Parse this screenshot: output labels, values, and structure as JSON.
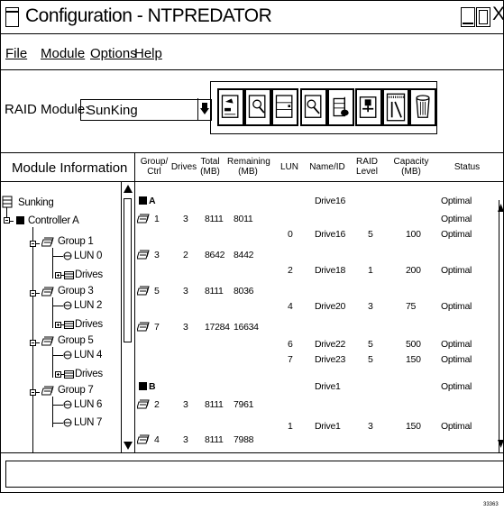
{
  "window": {
    "title": "Configuration - NTPREDATOR",
    "close_glyph": "X"
  },
  "menu": [
    {
      "label": "File"
    },
    {
      "label": "Module"
    },
    {
      "label": "Options"
    },
    {
      "label": "Help"
    }
  ],
  "raid": {
    "label": "RAID Module:",
    "value": "SunKing"
  },
  "toolbar": {
    "icons": [
      "configuration-icon",
      "status-icon",
      "maintenance-icon",
      "recovery-icon",
      "module-profile-icon",
      "add-module-icon",
      "tuning-icon",
      "delete-icon"
    ]
  },
  "left_header": "Module Information",
  "tree": {
    "root": "Sunking",
    "controller": "Controller A",
    "groups": [
      {
        "label": "Group 1",
        "lun": "LUN 0",
        "drives": "Drives"
      },
      {
        "label": "Group 3",
        "lun": "LUN 2",
        "drives": "Drives"
      },
      {
        "label": "Group 5",
        "lun": "LUN 4",
        "drives": "Drives"
      },
      {
        "label": "Group 7",
        "luns": [
          "LUN 6",
          "LUN 7"
        ]
      }
    ]
  },
  "columns": {
    "group_ctrl": [
      "Group/",
      "Ctrl"
    ],
    "drives": "Drives",
    "total": [
      "Total",
      "(MB)"
    ],
    "remaining": [
      "Remaining",
      "(MB)"
    ],
    "lun": "LUN",
    "name_id": "Name/ID",
    "raid_level": [
      "RAID",
      "Level"
    ],
    "capacity": [
      "Capacity",
      "(MB)"
    ],
    "status": "Status"
  },
  "rows": {
    "ctrlA": {
      "ctrl": "A",
      "name": "Drive16",
      "status": "Optimal"
    },
    "g1": {
      "group": "1",
      "drives": "3",
      "total": "8111",
      "remaining": "8011",
      "status": "Optimal"
    },
    "l0": {
      "lun": "0",
      "name": "Drive16",
      "raid": "5",
      "capacity": "100",
      "status": "Optimal"
    },
    "g3": {
      "group": "3",
      "drives": "2",
      "total": "8642",
      "remaining": "8442"
    },
    "l2": {
      "lun": "2",
      "name": "Drive18",
      "raid": "1",
      "capacity": "200",
      "status": "Optimal"
    },
    "g5": {
      "group": "5",
      "drives": "3",
      "total": "8111",
      "remaining": "8036"
    },
    "l4": {
      "lun": "4",
      "name": "Drive20",
      "raid": "3",
      "capacity": "75",
      "status": "Optimal"
    },
    "g7": {
      "group": "7",
      "drives": "3",
      "total": "17284",
      "remaining": "16634"
    },
    "l6": {
      "lun": "6",
      "name": "Drive22",
      "raid": "5",
      "capacity": "500",
      "status": "Optimal"
    },
    "l7": {
      "lun": "7",
      "name": "Drive23",
      "raid": "5",
      "capacity": "150",
      "status": "Optimal"
    },
    "ctrlB": {
      "ctrl": "B",
      "name": "Drive1",
      "status": "Optimal"
    },
    "g2": {
      "group": "2",
      "drives": "3",
      "total": "8111",
      "remaining": "7961"
    },
    "l1": {
      "lun": "1",
      "name": "Drive1",
      "raid": "3",
      "capacity": "150",
      "status": "Optimal"
    },
    "g4": {
      "group": "4",
      "drives": "3",
      "total": "8111",
      "remaining": "7988"
    }
  },
  "figure_number": "33363"
}
